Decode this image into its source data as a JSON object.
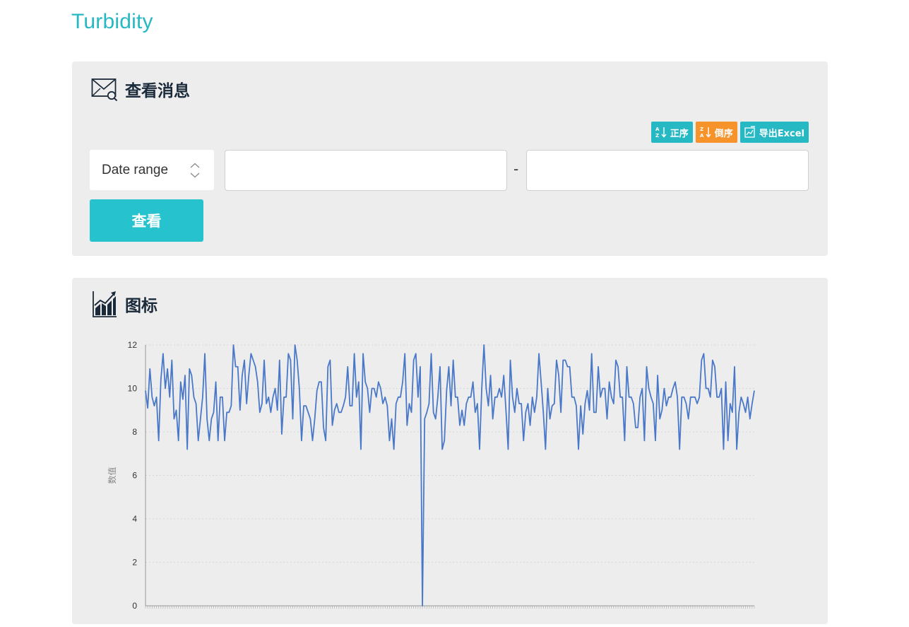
{
  "app": {
    "title": "Turbidity"
  },
  "query_panel": {
    "heading": "查看消息",
    "buttons": {
      "asc_label": "正序",
      "desc_label": "倒序",
      "export_label": "导出Excel"
    },
    "range_select": {
      "selected": "Date range"
    },
    "date_from": {
      "value": ""
    },
    "date_to": {
      "value": ""
    },
    "separator": "-",
    "view_button_label": "查看"
  },
  "chart_panel": {
    "heading": "图标"
  },
  "colors": {
    "accent": "#26b9c4",
    "orange": "#f6932b",
    "line": "#4a78c8",
    "panel": "#ededed"
  },
  "chart_data": {
    "type": "line",
    "title": "",
    "xlabel": "",
    "ylabel": "数值",
    "ylim": [
      0,
      12
    ],
    "yticks": [
      0,
      2,
      4,
      6,
      8,
      10,
      12
    ],
    "grid": "horizontal-dashed",
    "series": [
      {
        "values": [
          9.9,
          9.1,
          10.9,
          9.6,
          9.2,
          9.6,
          7.6,
          10.4,
          11.6,
          10.0,
          10.9,
          9.6,
          11.3,
          8.6,
          9.0,
          7.6,
          10.3,
          9.5,
          10.6,
          7.2,
          10.9,
          10.6,
          9.6,
          9.3,
          7.6,
          8.6,
          9.6,
          11.6,
          8.6,
          7.6,
          8.6,
          8.9,
          10.3,
          7.6,
          9.6,
          9.6,
          7.6,
          8.9,
          8.9,
          9.2,
          12.0,
          11.0,
          11.0,
          9.0,
          10.6,
          11.3,
          9.3,
          10.6,
          11.6,
          11.3,
          11.0,
          10.3,
          8.9,
          9.3,
          11.3,
          9.3,
          9.6,
          8.9,
          9.6,
          10.0,
          9.0,
          11.3,
          7.9,
          9.6,
          9.6,
          11.6,
          11.3,
          8.6,
          12.0,
          11.3,
          10.0,
          7.6,
          9.2,
          9.2,
          8.9,
          8.6,
          7.6,
          8.6,
          9.9,
          10.3,
          10.3,
          8.2,
          7.6,
          11.0,
          11.3,
          8.3,
          9.0,
          9.3,
          8.9,
          8.9,
          9.2,
          9.6,
          11.0,
          9.2,
          9.2,
          11.6,
          9.6,
          10.3,
          7.2,
          11.6,
          10.3,
          10.0,
          8.9,
          10.0,
          10.0,
          9.6,
          10.3,
          10.0,
          9.3,
          9.6,
          9.2,
          7.6,
          8.6,
          7.2,
          9.3,
          9.6,
          9.6,
          10.3,
          11.6,
          8.3,
          9.3,
          8.9,
          11.3,
          11.6,
          9.6,
          11.0,
          0.0,
          8.6,
          8.9,
          9.3,
          11.6,
          8.9,
          8.6,
          9.6,
          11.0,
          7.2,
          7.6,
          9.9,
          11.0,
          9.2,
          11.3,
          9.6,
          9.6,
          8.3,
          9.0,
          8.3,
          9.3,
          9.6,
          9.6,
          10.3,
          8.9,
          9.3,
          7.2,
          10.0,
          12.0,
          10.0,
          9.2,
          10.6,
          8.6,
          9.6,
          9.6,
          10.0,
          9.6,
          10.6,
          9.0,
          7.2,
          11.3,
          9.6,
          8.9,
          10.0,
          9.3,
          9.3,
          7.6,
          8.9,
          9.3,
          8.3,
          9.6,
          8.9,
          9.6,
          11.6,
          10.3,
          8.9,
          7.2,
          10.0,
          8.6,
          9.2,
          9.3,
          11.3,
          10.6,
          8.9,
          11.3,
          11.3,
          11.0,
          11.0,
          9.6,
          9.6,
          9.2,
          7.2,
          9.2,
          7.9,
          9.3,
          9.9,
          9.0,
          11.6,
          8.9,
          8.9,
          11.0,
          9.6,
          10.0,
          10.0,
          8.6,
          10.3,
          9.6,
          9.3,
          11.3,
          11.0,
          9.6,
          9.6,
          7.6,
          11.0,
          9.6,
          9.6,
          9.3,
          8.2,
          8.2,
          9.6,
          10.0,
          7.6,
          11.0,
          10.0,
          9.6,
          9.3,
          7.6,
          10.6,
          8.6,
          9.0,
          10.0,
          9.2,
          9.6,
          9.6,
          10.0,
          10.3,
          9.6,
          7.2,
          9.6,
          9.6,
          9.3,
          8.6,
          9.6,
          9.6,
          9.6,
          9.3,
          9.6,
          11.3,
          11.6,
          10.0,
          10.0,
          9.6,
          11.3,
          11.0,
          9.6,
          9.6,
          10.0,
          7.2,
          10.3,
          7.6,
          9.3,
          8.9,
          11.0,
          7.2,
          8.9,
          9.6,
          9.3,
          8.9,
          9.6,
          8.6,
          9.3,
          9.9
        ]
      }
    ]
  }
}
